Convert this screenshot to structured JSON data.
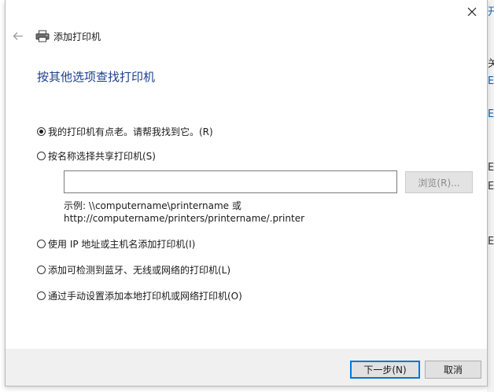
{
  "window": {
    "title": "添加打印机",
    "close_icon": "close-icon",
    "back_icon": "arrow-left-icon",
    "printer_icon": "printer-icon"
  },
  "page": {
    "heading": "按其他选项查找打印机"
  },
  "options": [
    {
      "label": "我的打印机有点老。请帮我找到它。(R)",
      "checked": true
    },
    {
      "label": "按名称选择共享打印机(S)",
      "checked": false
    },
    {
      "label": "使用 IP 地址或主机名添加打印机(I)",
      "checked": false
    },
    {
      "label": "添加可检测到蓝牙、无线或网络的打印机(L)",
      "checked": false
    },
    {
      "label": "通过手动设置添加本地打印机或网络打印机(O)",
      "checked": false
    }
  ],
  "shared_printer": {
    "input_value": "",
    "browse_label": "浏览(R)...",
    "example_line1": "示例: \\\\computername\\printername 或",
    "example_line2": "http://computername/printers/printername/.printer"
  },
  "footer": {
    "next_label": "下一步(N)",
    "cancel_label": "取消"
  },
  "background": {
    "fragments": [
      "开",
      "关",
      "E",
      "E",
      "E",
      "E",
      "E"
    ]
  },
  "colors": {
    "heading": "#1c3f8f",
    "primary_border": "#0078d7",
    "footer_bg": "#f0f0f0"
  }
}
